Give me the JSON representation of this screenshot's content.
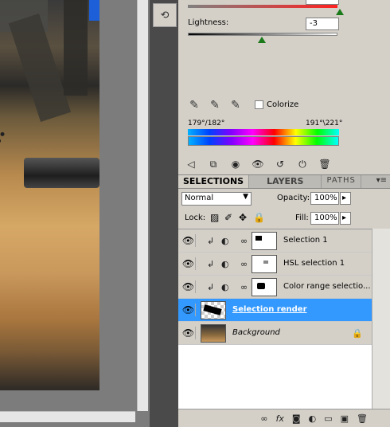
{
  "hsl": {
    "lightness_label": "Lightness:",
    "lightness_value": "-3",
    "colorize_label": "Colorize",
    "hue_range_left": "179°/182°",
    "hue_range_right": "191°\\221°"
  },
  "panel_tabs": {
    "selections": "SELECTIONS",
    "layers": "LAYERS",
    "paths": "PATHS",
    "menu": "▾≡"
  },
  "layer_controls": {
    "blend_mode": "Normal",
    "opacity_label": "Opacity:",
    "opacity_value": "100%",
    "lock_label": "Lock:",
    "fill_label": "Fill:",
    "fill_value": "100%"
  },
  "layers": [
    {
      "name": "Selection 1",
      "selected": false
    },
    {
      "name": "HSL selection 1",
      "selected": false
    },
    {
      "name": "Color range selectio...",
      "selected": false
    },
    {
      "name": "Selection render",
      "selected": true
    },
    {
      "name": "Background",
      "selected": false
    }
  ],
  "icons": {
    "adjustment_dock": "adjustment-history-icon",
    "eyedropper": "eyedropper-icon",
    "eyedropper_add": "eyedropper-add-icon",
    "eyedropper_subtract": "eyedropper-subtract-icon",
    "back": "back-arrow-icon",
    "clip": "clip-to-layer-icon",
    "mask": "mask-icon",
    "visibility": "eye-icon",
    "reset": "reset-icon",
    "toggle": "power-icon",
    "delete": "trash-icon",
    "link": "link-icon",
    "fx": "fx-icon",
    "new_mask": "add-mask-icon",
    "new_adjustment": "adjustment-layer-icon",
    "new_group": "folder-icon",
    "new_layer": "new-layer-icon",
    "lock": "lock-icon"
  },
  "colors": {
    "selected_layer": "#3399ff",
    "panel_bg": "#d4d0c8",
    "slider_thumb": "#1a7a1a"
  }
}
